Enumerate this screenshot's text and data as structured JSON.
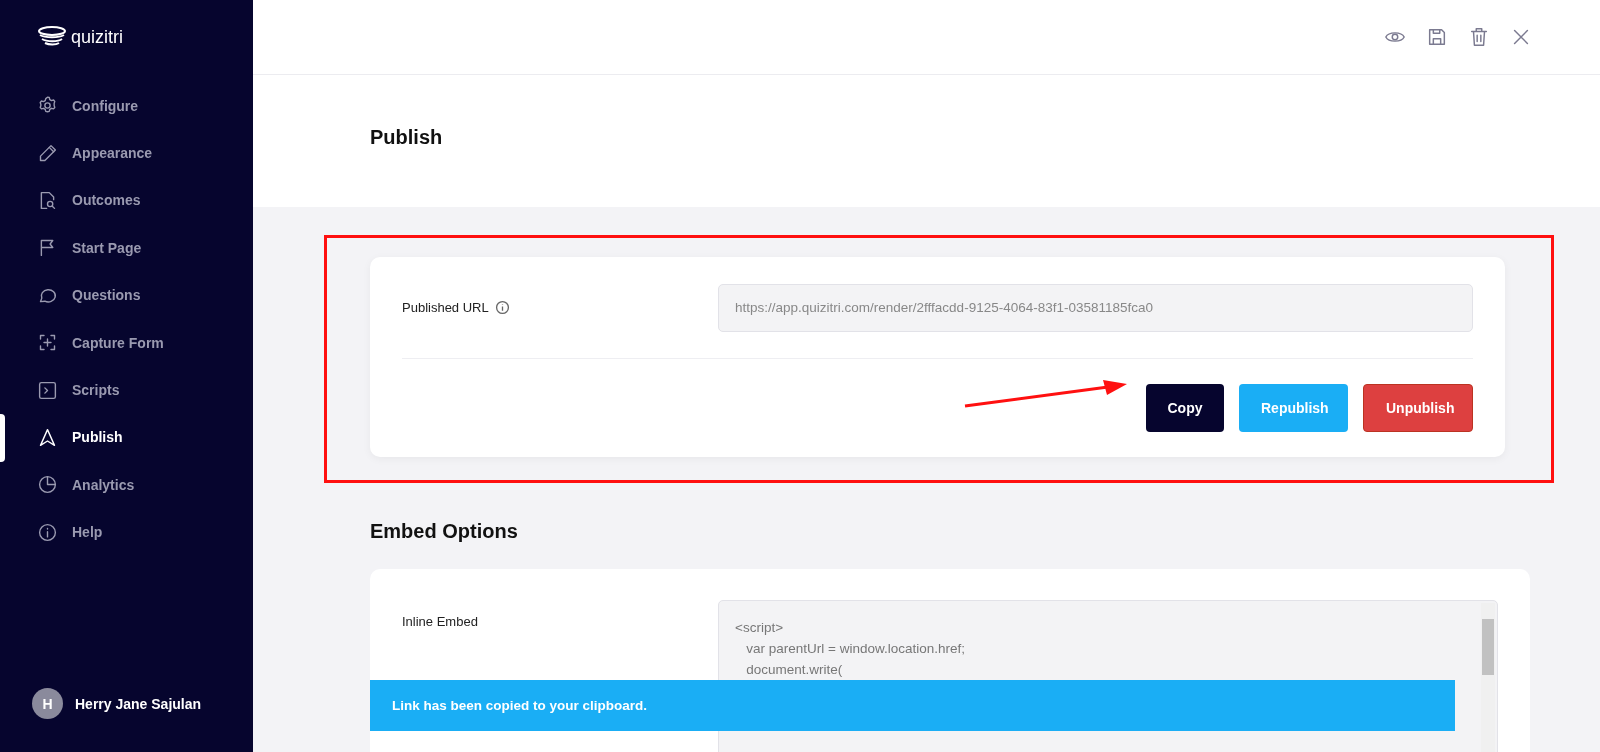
{
  "brand": {
    "name": "quizitri"
  },
  "sidebar": {
    "items": [
      {
        "label": "Configure",
        "selected": false
      },
      {
        "label": "Appearance",
        "selected": false
      },
      {
        "label": "Outcomes",
        "selected": false
      },
      {
        "label": "Start Page",
        "selected": false
      },
      {
        "label": "Questions",
        "selected": false
      },
      {
        "label": "Capture Form",
        "selected": false
      },
      {
        "label": "Scripts",
        "selected": false
      },
      {
        "label": "Publish",
        "selected": true
      },
      {
        "label": "Analytics",
        "selected": false
      },
      {
        "label": "Help",
        "selected": false
      }
    ],
    "user": {
      "initial": "H",
      "name": "Herry Jane Sajulan"
    }
  },
  "page_title": "Publish",
  "publish": {
    "label": "Published URL",
    "url": "https://app.quizitri.com/render/2fffacdd-9125-4064-83f1-03581185fca0",
    "buttons": [
      {
        "label": "Copy",
        "kind": "dark"
      },
      {
        "label": "Republish",
        "kind": "primary"
      },
      {
        "label": "Unpublish",
        "kind": "danger"
      }
    ]
  },
  "embed": {
    "title": "Embed Options",
    "label": "Inline Embed",
    "code_lines": [
      "<script>",
      "   var parentUrl = window.location.href;",
      "   document.write("
    ]
  },
  "toast": {
    "message": "Link has been copied to your clipboard."
  }
}
